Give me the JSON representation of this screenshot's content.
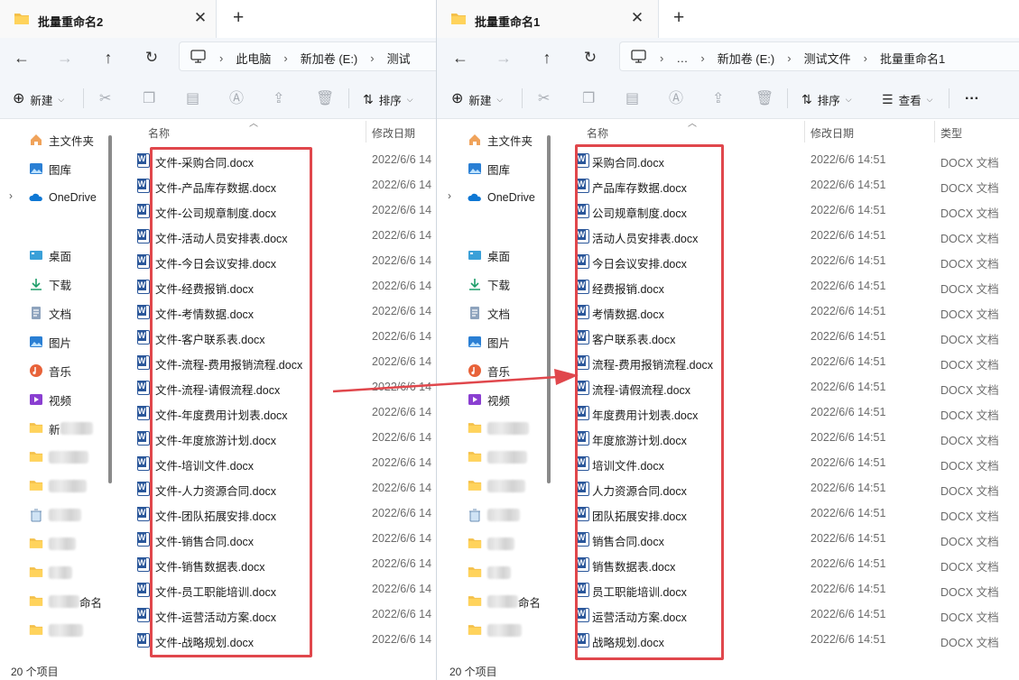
{
  "left_window": {
    "tab_title": "批量重命名2",
    "breadcrumb": [
      "此电脑",
      "新加卷 (E:)",
      "测试"
    ],
    "toolbar": {
      "new_label": "新建",
      "sort_label": "排序"
    },
    "nav": {
      "home": "主文件夹",
      "gallery": "图库",
      "onedrive": "OneDrive",
      "desktop": "桌面",
      "downloads": "下载",
      "documents": "文档",
      "pictures": "图片",
      "music": "音乐",
      "videos": "视频",
      "folder_frag_1": "新",
      "folder_frag_2": "命名"
    },
    "columns": {
      "name": "名称",
      "date": "修改日期"
    },
    "date_value": "2022/6/6 14",
    "files": [
      "文件-采购合同.docx",
      "文件-产品库存数据.docx",
      "文件-公司规章制度.docx",
      "文件-活动人员安排表.docx",
      "文件-今日会议安排.docx",
      "文件-经费报销.docx",
      "文件-考情数据.docx",
      "文件-客户联系表.docx",
      "文件-流程-费用报销流程.docx",
      "文件-流程-请假流程.docx",
      "文件-年度费用计划表.docx",
      "文件-年度旅游计划.docx",
      "文件-培训文件.docx",
      "文件-人力资源合同.docx",
      "文件-团队拓展安排.docx",
      "文件-销售合同.docx",
      "文件-销售数据表.docx",
      "文件-员工职能培训.docx",
      "文件-运营活动方案.docx",
      "文件-战略规划.docx"
    ],
    "status": "20 个项目"
  },
  "right_window": {
    "tab_title": "批量重命名1",
    "breadcrumb": [
      "…",
      "新加卷 (E:)",
      "测试文件",
      "批量重命名1"
    ],
    "toolbar": {
      "new_label": "新建",
      "sort_label": "排序",
      "view_label": "查看",
      "more_label": "···"
    },
    "nav": {
      "home": "主文件夹",
      "gallery": "图库",
      "onedrive": "OneDrive",
      "desktop": "桌面",
      "downloads": "下载",
      "documents": "文档",
      "pictures": "图片",
      "music": "音乐",
      "videos": "视频",
      "folder_frag_2": "命名"
    },
    "columns": {
      "name": "名称",
      "date": "修改日期",
      "type": "类型"
    },
    "date_value": "2022/6/6 14:51",
    "type_value": "DOCX 文档",
    "files": [
      "采购合同.docx",
      "产品库存数据.docx",
      "公司规章制度.docx",
      "活动人员安排表.docx",
      "今日会议安排.docx",
      "经费报销.docx",
      "考情数据.docx",
      "客户联系表.docx",
      "流程-费用报销流程.docx",
      "流程-请假流程.docx",
      "年度费用计划表.docx",
      "年度旅游计划.docx",
      "培训文件.docx",
      "人力资源合同.docx",
      "团队拓展安排.docx",
      "销售合同.docx",
      "销售数据表.docx",
      "员工职能培训.docx",
      "运营活动方案.docx",
      "战略规划.docx"
    ],
    "status": "20 个项目"
  },
  "colors": {
    "highlight": "#e0474c",
    "chrome": "#f3f6fa",
    "word_blue": "#2b579a",
    "folder": "#f4c04a"
  }
}
